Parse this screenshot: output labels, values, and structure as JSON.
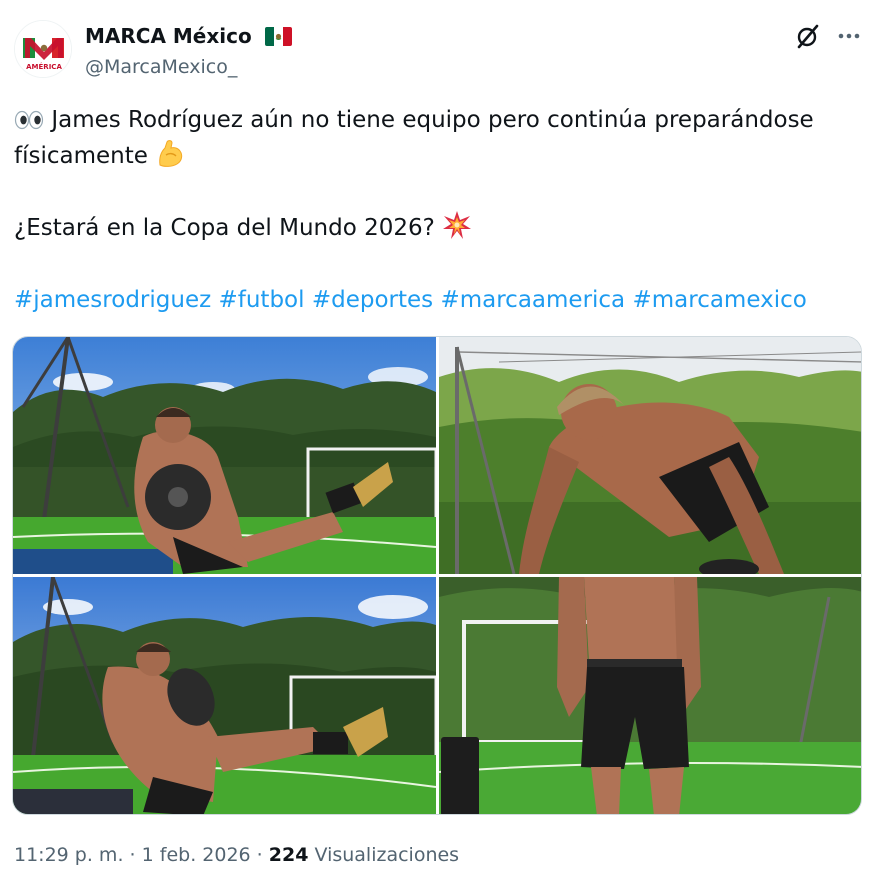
{
  "author": {
    "name": "MARCA México",
    "handle": "@MarcaMexico_",
    "avatar_text": "AMÉRICA"
  },
  "tweet": {
    "line1": "James Rodríguez aún no tiene equipo pero continúa preparándose",
    "line2": "físicamente",
    "line3": "¿Estará en la Copa del Mundo 2026?",
    "hashtags": [
      "#jamesrodriguez",
      "#futbol",
      "#deportes",
      "#marcaamerica",
      "#marcamexico"
    ]
  },
  "meta": {
    "time": "11:29 p. m.",
    "separator": "·",
    "date": "1 feb. 2026",
    "views_count": "224",
    "views_label": "Visualizaciones"
  },
  "colors": {
    "link": "#1d9bf0",
    "secondary_text": "#536471",
    "primary_text": "#0f1419",
    "border": "#cfd9de"
  },
  "icons": {
    "eyes": "eyes-emoji-icon",
    "flexed_biceps": "flexed-biceps-emoji-icon",
    "collision": "collision-emoji-icon",
    "flag": "mexico-flag-icon",
    "grok": "grok-icon",
    "more": "more-options-icon"
  }
}
